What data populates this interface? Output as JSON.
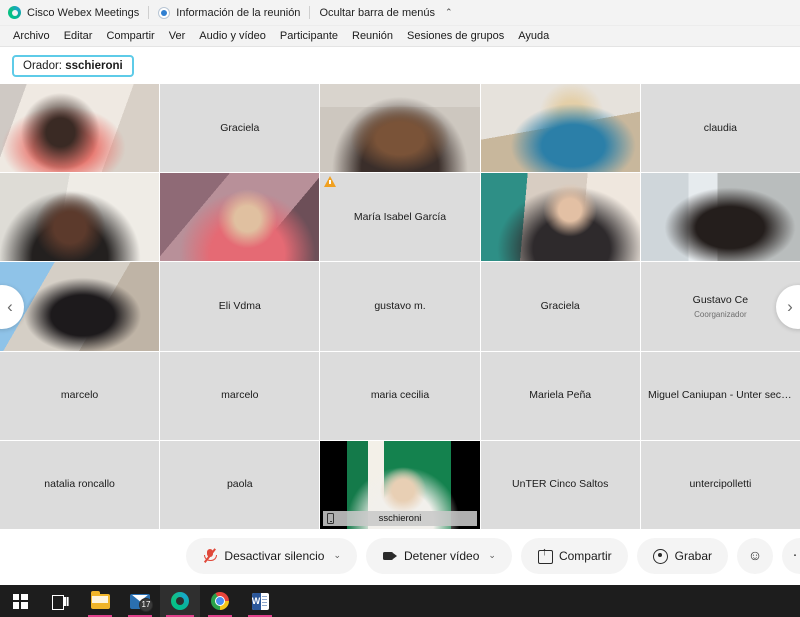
{
  "titlebar": {
    "app_name": "Cisco Webex Meetings",
    "meeting_info": "Información de la reunión",
    "hide_menu": "Ocultar barra de menús",
    "chevron": "⌃"
  },
  "menubar": {
    "items": [
      {
        "label": "Archivo"
      },
      {
        "label": "Editar"
      },
      {
        "label": "Compartir"
      },
      {
        "label": "Ver"
      },
      {
        "label": "Audio y vídeo"
      },
      {
        "label": "Participante"
      },
      {
        "label": "Reunión"
      },
      {
        "label": "Sesiones de grupos"
      },
      {
        "label": "Ayuda"
      }
    ]
  },
  "speaker": {
    "prefix": "Orador:",
    "name": "sschieroni",
    "border_color": "#5ecbe8"
  },
  "grid": {
    "prev_arrow": "‹",
    "next_arrow": "›",
    "tiles": [
      {
        "name": "",
        "video": "v1",
        "kind": "video"
      },
      {
        "name": "Graciela",
        "kind": "name"
      },
      {
        "name": "",
        "video": "v2",
        "kind": "video"
      },
      {
        "name": "",
        "video": "v3",
        "kind": "video"
      },
      {
        "name": "claudia",
        "kind": "name"
      },
      {
        "name": "",
        "video": "v4",
        "kind": "video"
      },
      {
        "name": "",
        "video": "v5",
        "kind": "video"
      },
      {
        "name": "María Isabel García",
        "kind": "name",
        "warning": true
      },
      {
        "name": "",
        "video": "v6",
        "kind": "video"
      },
      {
        "name": "",
        "video": "v7",
        "kind": "video"
      },
      {
        "name": "",
        "video": "v8",
        "kind": "video"
      },
      {
        "name": "Eli Vdma",
        "kind": "name"
      },
      {
        "name": "gustavo m.",
        "kind": "name"
      },
      {
        "name": "Graciela",
        "kind": "name"
      },
      {
        "name": "Gustavo Ce",
        "role": "Coorganizador",
        "kind": "name"
      },
      {
        "name": "marcelo",
        "kind": "name"
      },
      {
        "name": "marcelo",
        "kind": "name"
      },
      {
        "name": "maria cecilia",
        "kind": "name"
      },
      {
        "name": "Mariela Peña",
        "kind": "name"
      },
      {
        "name": "Miguel Caniupan - Unter secc...",
        "kind": "name"
      },
      {
        "name": "natalia roncallo",
        "kind": "name"
      },
      {
        "name": "paola",
        "kind": "name"
      },
      {
        "name": "sschieroni",
        "kind": "video",
        "video": "v9",
        "active": true,
        "device": "mobile"
      },
      {
        "name": "UnTER Cinco Saltos",
        "kind": "name"
      },
      {
        "name": "untercipolletti",
        "kind": "name"
      }
    ],
    "active_border_color": "#1fb8e8"
  },
  "controls": {
    "mute_label": "Desactivar silencio",
    "video_label": "Detener vídeo",
    "share_label": "Compartir",
    "record_label": "Grabar",
    "reactions_label": "☺",
    "more_label": "···",
    "caret": "⌄",
    "mute_color": "#e0483a"
  },
  "taskbar": {
    "mail_badge": "17",
    "items": [
      {
        "name": "start"
      },
      {
        "name": "task-view"
      },
      {
        "name": "file-explorer"
      },
      {
        "name": "mail"
      },
      {
        "name": "webex"
      },
      {
        "name": "chrome"
      },
      {
        "name": "word"
      }
    ]
  }
}
